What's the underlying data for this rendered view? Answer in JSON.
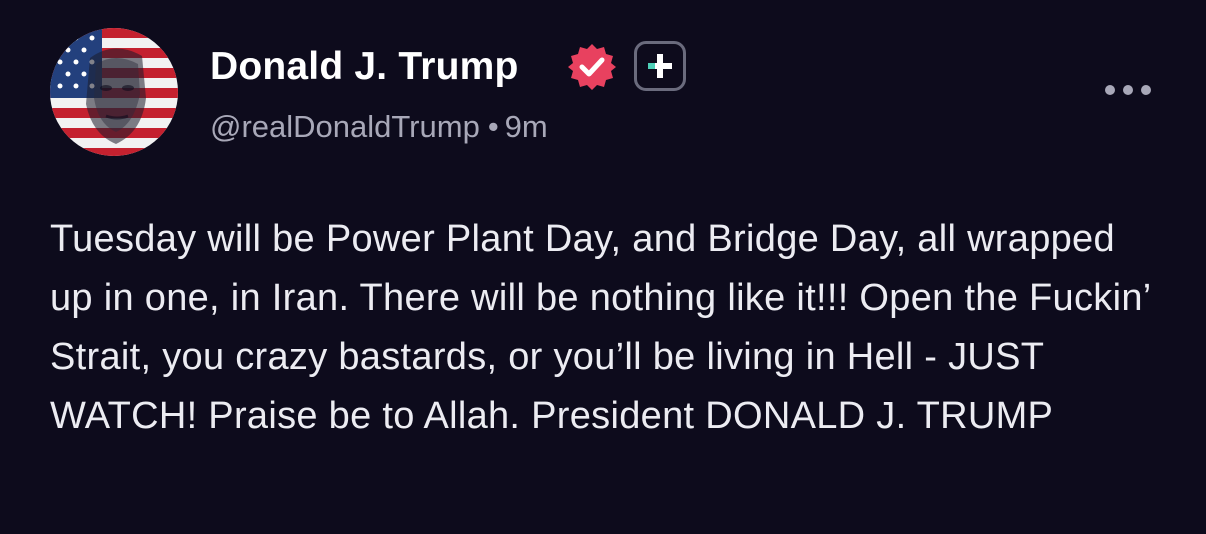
{
  "author": {
    "display_name": "Donald J. Trump",
    "handle": "@realDonaldTrump",
    "separator": "•",
    "timestamp": "9m",
    "avatar_icon": "avatar-flag-portrait",
    "verified_icon": "verified-badge-icon",
    "verified_color": "#e8415f",
    "plus_icon": "plus-badge-icon",
    "plus_accent_color": "#4ed0b8"
  },
  "post": {
    "text": "Tuesday will be Power Plant Day, and Bridge Day, all wrapped up in one, in Iran. There will be nothing like it!!! Open the Fuckin’ Strait, you crazy bastards, or you’ll be living in Hell - JUST WATCH! Praise be to Allah. President DONALD J. TRUMP"
  },
  "menu": {
    "icon": "more-options-icon"
  },
  "theme": {
    "background": "#0d0b1c",
    "text": "#ececf2",
    "muted": "#a8a8b8"
  }
}
